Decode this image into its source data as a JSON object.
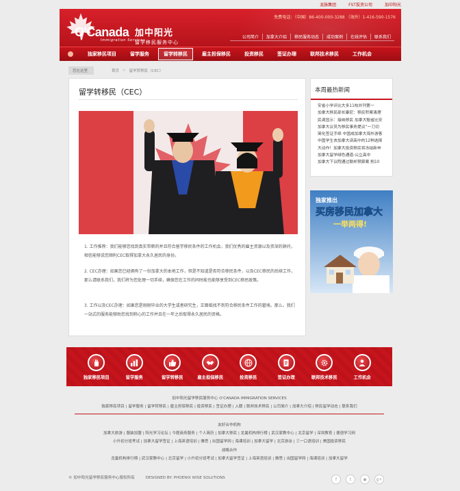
{
  "top_links": [
    "龙脉集团",
    "FST投资公司",
    "加中阳光"
  ],
  "header": {
    "brand": "O'Canada",
    "brand_sub": "Immigration Services",
    "brand_cn": "加中阳光",
    "brand_cn_sub": "留学移民服务中心",
    "hotline": "免费电话：（中国）86-400-000-3288   （海外）1-416-590-1576",
    "subnav": [
      "公司简介",
      "加拿大介绍",
      "移民服务动态",
      "成功案例",
      "在线评估",
      "联系我们"
    ]
  },
  "nav": {
    "items": [
      "独家移民项目",
      "留学服务",
      "留学转移民",
      "雇主担保移民",
      "投资移民",
      "签证办理",
      "联邦技术移民",
      "工作机会"
    ],
    "active_index": 2
  },
  "breadcrumb": {
    "here": "您在这里",
    "items": [
      "首页",
      "留学转移民（CEC）"
    ]
  },
  "article": {
    "title": "留学转移民（CEC）",
    "paragraphs": [
      "1. 工作推荐：我们能够您找到真实带薪的并且符合留学移民条件的工作机会，我们优秀的雇主资源以及资深的顾问，相信能够说您顺利CEC取得加拿大永久居民的身份。",
      "2. CEC办理：如果您已经拥有了一份加拿大的本地工作，但是不知道是否符合移民条件，以及CEC移民的后续工作，那么请联系我们，我们将为您处理一切手续，确保您在工作的同时能也能够享受到CEC移民政策。",
      "3. 工作以及CEC办理：如果您是刚刚毕业的大学生或者研究生，正面临找不到符合移民条件工作的窘境。那么，我们一站式的服务能够助您找到称心的工作并且在一年之后取得永久居民的资格。"
    ]
  },
  "news": {
    "title": "本周最热新闻",
    "items": [
      "安省小学评比大多11校并列第一",
      "加拿大移民部长康尼：移民积案清理",
      "民调显示：接纳移民 加拿大魁省比安",
      "加拿大议员为移民事务提议“一刀切",
      "简化签证手续 中国成加拿大海外游客",
      "中国学生去加拿大读高中的12种选择",
      "大动作！加拿大投资移民将冻结新申",
      "加拿大留学绿色通道-公立高中",
      "加拿大下议院通过联邦预算案 削10"
    ]
  },
  "ad": {
    "line1": "独家推出",
    "line2": "买房移民加拿大",
    "line3": "一举两得!"
  },
  "services": [
    "独家移民项目",
    "留学服务",
    "留学转移民",
    "雇主担保移民",
    "投资移民",
    "签证办理",
    "联邦技术移民",
    "工作机会"
  ],
  "footer": {
    "org": "加中阳光留学移民服务中心    O'CANADA IMMIGRATION SERVICES",
    "links": [
      "独家移民项目",
      "留学服务",
      "留学转移民",
      "雇主担保移民",
      "投资移民",
      "签证办理",
      "入籍",
      "联邦技术移民",
      "公司简介",
      "加拿大介绍",
      "移民留学动态",
      "联系我们"
    ],
    "partners_title": "友好合作机构",
    "partners_row1": [
      "加拿大旅游",
      "服装加盟",
      "阳光学习论坛",
      "今题商务服务",
      "个人简历",
      "加拿大移民",
      "龙巢机构排行榜",
      "武汉家教中心",
      "北京留学",
      "深圳教育",
      "德语学习网"
    ],
    "partners_row2": [
      "小升初分班考试",
      "加拿大留学签证",
      "上海英语培训",
      "雅思",
      "出国留学网",
      "海课培训",
      "加拿大留学",
      "北京游泳",
      "三一口语培训",
      "美国投资移民"
    ],
    "strategic_title": "战略合作",
    "strategic_row": [
      "龙巢机构排行榜",
      "武汉家教中心",
      "北京留学",
      "小升初分班考试",
      "加拿大留学签证",
      "上海英语培训",
      "雅思",
      "出国留学网",
      "海课培训",
      "加拿大留学"
    ],
    "copyright": "© 加中阳光留学移民服务中心版权所有",
    "designed": "DESIGNED BY: PHOENIX WISE SOLUTIONS"
  },
  "colors": {
    "brand_red": "#c8141c",
    "page_bg": "#ececec"
  }
}
